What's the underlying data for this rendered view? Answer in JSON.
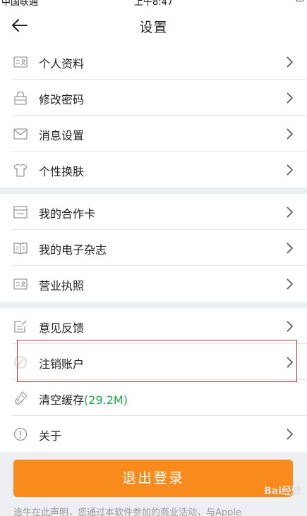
{
  "status_bar": {
    "carrier": "中国联通",
    "time": "上午8:47"
  },
  "nav": {
    "title": "设置",
    "back_icon": "arrow-left-icon"
  },
  "groups": [
    {
      "items": [
        {
          "label": "个人资料",
          "icon": "profile-card-icon"
        },
        {
          "label": "修改密码",
          "icon": "lock-icon"
        },
        {
          "label": "消息设置",
          "icon": "envelope-icon"
        },
        {
          "label": "个性换肤",
          "icon": "shirt-icon"
        }
      ]
    },
    {
      "items": [
        {
          "label": "我的合作卡",
          "icon": "card-icon"
        },
        {
          "label": "我的电子杂志",
          "icon": "book-icon"
        },
        {
          "label": "营业执照",
          "icon": "license-icon"
        }
      ]
    },
    {
      "items": [
        {
          "label": "意见反馈",
          "icon": "edit-icon"
        },
        {
          "label": "注销账户",
          "icon": "cancel-icon"
        },
        {
          "label": "清空缓存",
          "cache_size": "(29.2M)",
          "icon": "broom-icon"
        },
        {
          "label": "关于",
          "icon": "info-icon"
        }
      ]
    }
  ],
  "logout_label": "退出登录",
  "disclaimer": "途牛在此声明，您通过本软件参加的商业活动，与Apple",
  "watermark": "Bai经验",
  "colors": {
    "accent": "#f98b1c",
    "cache_green": "#1fa64a",
    "highlight_border": "#c4393f"
  }
}
